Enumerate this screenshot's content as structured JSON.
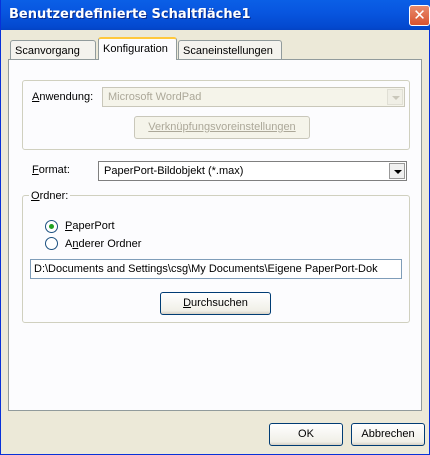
{
  "window": {
    "title": "Benutzerdefinierte Schaltfläche1",
    "close_glyph": "✕"
  },
  "tabs": [
    {
      "label": "Scanvorgang",
      "active": false
    },
    {
      "label": "Konfiguration",
      "active": true
    },
    {
      "label": "Scaneinstellungen",
      "active": false
    }
  ],
  "application": {
    "label_mnemonic": "A",
    "label_rest": "nwendung:",
    "value": "Microsoft WordPad",
    "link_button_label": "Verknüpfungsvoreinstellungen"
  },
  "format": {
    "label_mnemonic": "F",
    "label_rest": "ormat:",
    "value": "PaperPort-Bildobjekt (*.max)"
  },
  "folder": {
    "group_label_mnemonic": "O",
    "group_label_rest": "rdner:",
    "option1_mnemonic": "P",
    "option1_rest": "aperPort",
    "option2_prefix": "A",
    "option2_mnemonic": "n",
    "option2_rest": "derer Ordner",
    "selected": "PaperPort",
    "path": "D:\\Documents and Settings\\csg\\My Documents\\Eigene PaperPort-Dok",
    "browse_mnemonic": "D",
    "browse_rest": "urchsuchen"
  },
  "buttons": {
    "ok_label": "OK",
    "cancel_label": "Abbrechen"
  }
}
